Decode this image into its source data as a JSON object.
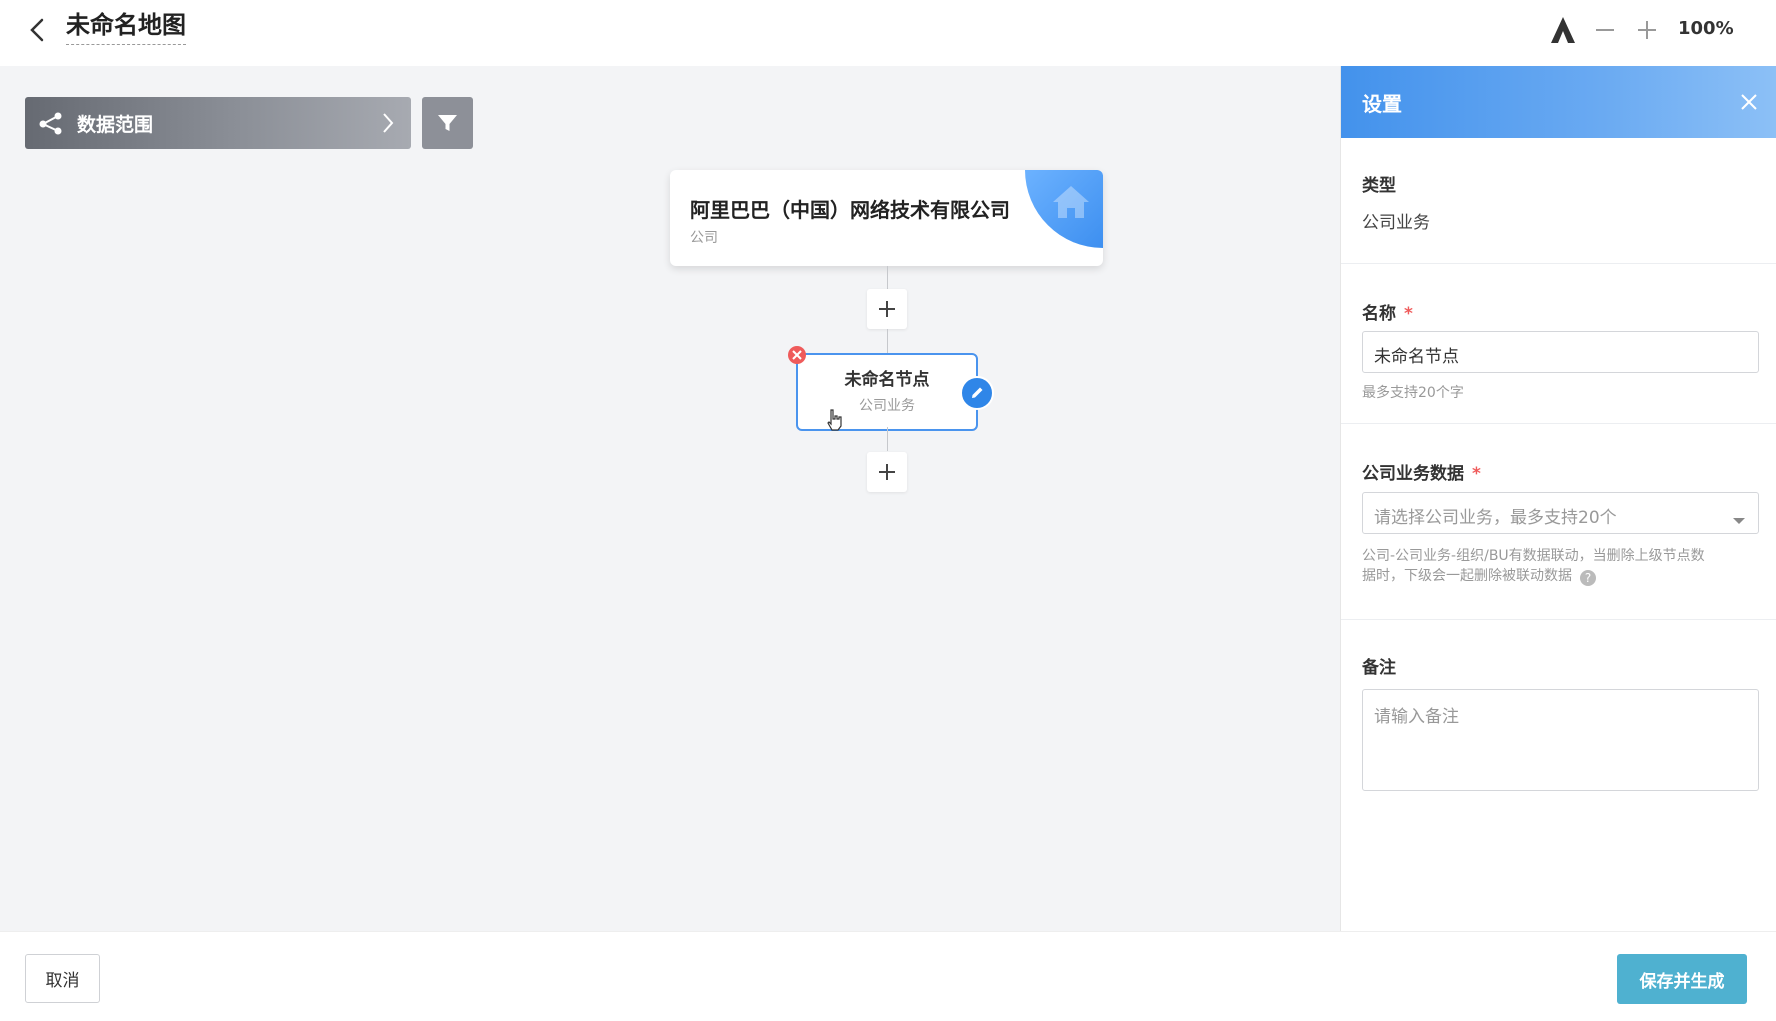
{
  "header": {
    "title": "未命名地图",
    "zoom_level": "100%",
    "icons": [
      "back-arrow-icon",
      "theme-icon",
      "zoom-out-icon",
      "zoom-in-icon"
    ]
  },
  "canvas": {
    "scope_label": "数据范围",
    "company_node": {
      "name": "阿里巴巴（中国）网络技术有限公司",
      "type": "公司"
    },
    "child_node": {
      "name": "未命名节点",
      "type": "公司业务"
    }
  },
  "settings_panel": {
    "title": "设置",
    "type_label": "类型",
    "type_value": "公司业务",
    "name_label": "名称",
    "required_mark": "*",
    "name_value": "未命名节点",
    "name_hint": "最多支持20个字",
    "business_label": "公司业务数据",
    "business_placeholder": "请选择公司业务，最多支持20个",
    "business_hint_line1": "公司-公司业务-组织/BU有数据联动，当删除上级节点数",
    "business_hint_line2": "据时，下级会一起删除被联动数据",
    "help_mark": "?",
    "notes_label": "备注",
    "notes_placeholder": "请输入备注"
  },
  "footer": {
    "cancel_label": "取消",
    "save_label": "保存并生成"
  },
  "colors": {
    "accent": "#4392ec",
    "save_button": "#4fb1d0",
    "required": "#ef5b5b",
    "canvas_bg": "#f3f4f6"
  }
}
